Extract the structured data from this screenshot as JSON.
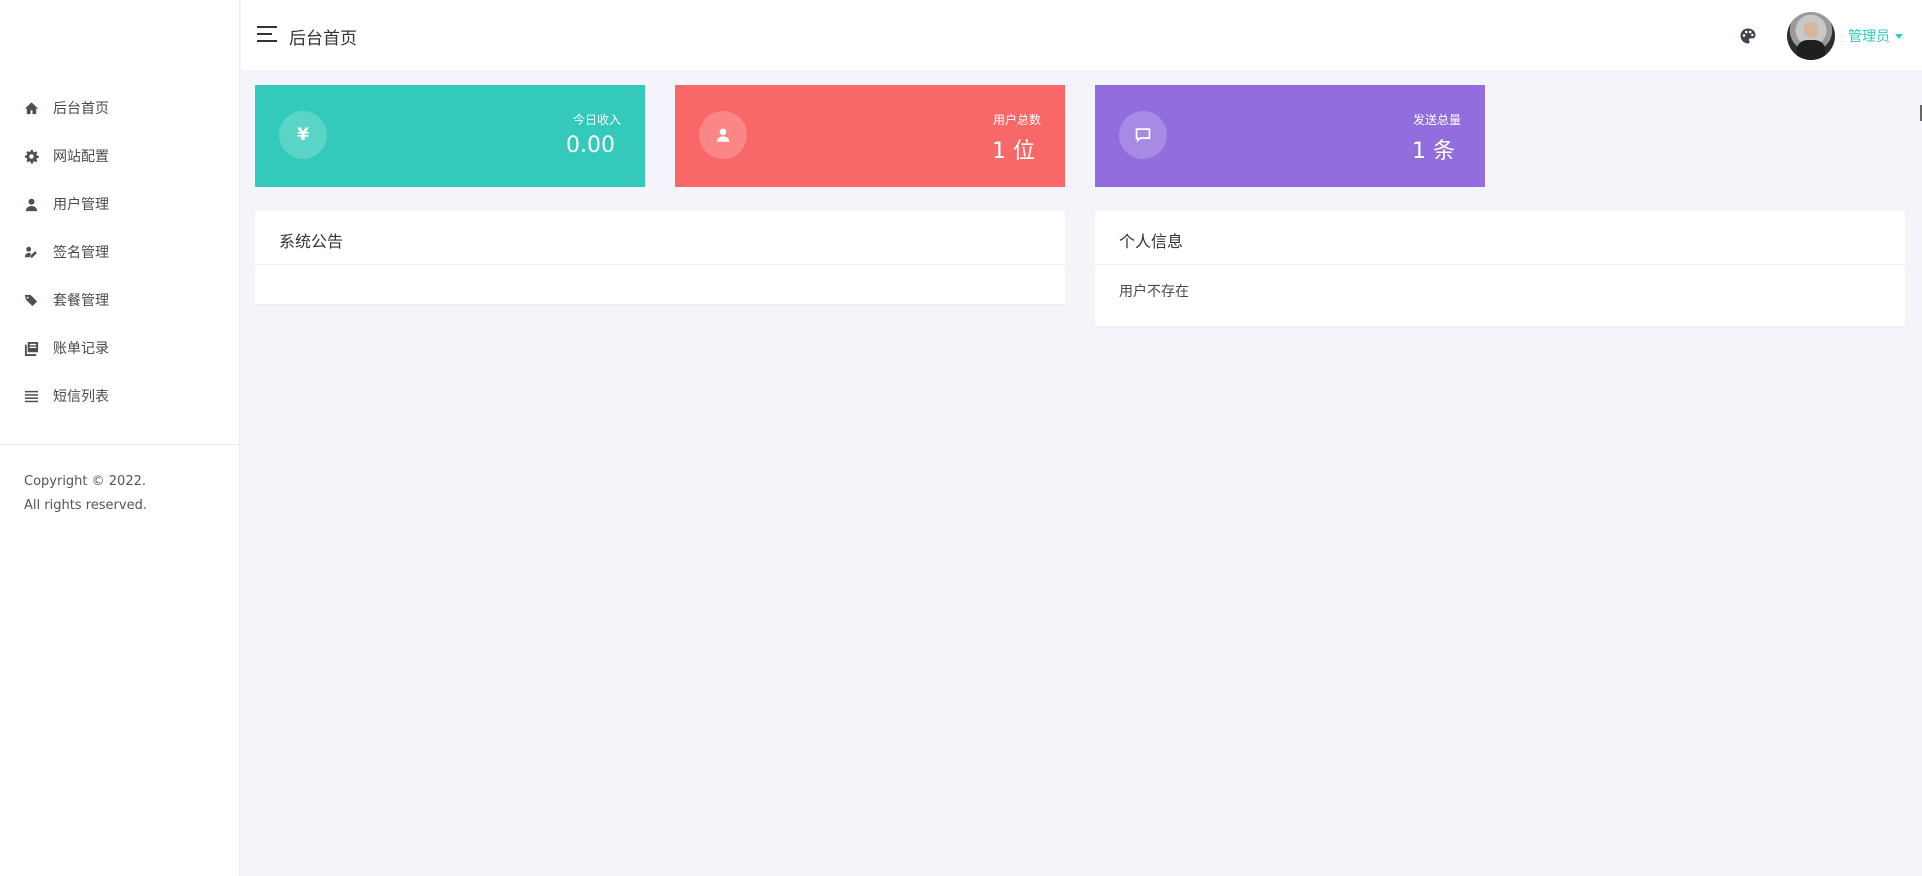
{
  "header": {
    "page_title": "后台首页",
    "user_name": "管理员"
  },
  "sidebar": {
    "items": [
      {
        "label": "后台首页",
        "icon": "home-icon"
      },
      {
        "label": "网站配置",
        "icon": "gear-icon"
      },
      {
        "label": "用户管理",
        "icon": "user-icon"
      },
      {
        "label": "签名管理",
        "icon": "signature-icon"
      },
      {
        "label": "套餐管理",
        "icon": "tags-icon"
      },
      {
        "label": "账单记录",
        "icon": "book-stack-icon"
      },
      {
        "label": "短信列表",
        "icon": "list-icon"
      }
    ],
    "copyright_line1": "Copyright © 2022.",
    "copyright_line2": "All rights reserved."
  },
  "stats": [
    {
      "label": "今日收入",
      "value": "0.00",
      "icon": "yen-icon",
      "color": "#33cabb",
      "glyph": "¥"
    },
    {
      "label": "用户总数",
      "value": "1 位",
      "icon": "user-icon",
      "color": "#f96868"
    },
    {
      "label": "发送总量",
      "value": "1 条",
      "icon": "message-icon",
      "color": "#926dde"
    }
  ],
  "panels": {
    "announcement": {
      "title": "系统公告",
      "body": ""
    },
    "profile": {
      "title": "个人信息",
      "body": "用户不存在"
    }
  },
  "colors": {
    "accent": "#33cabb",
    "background": "#f4f5fa"
  }
}
